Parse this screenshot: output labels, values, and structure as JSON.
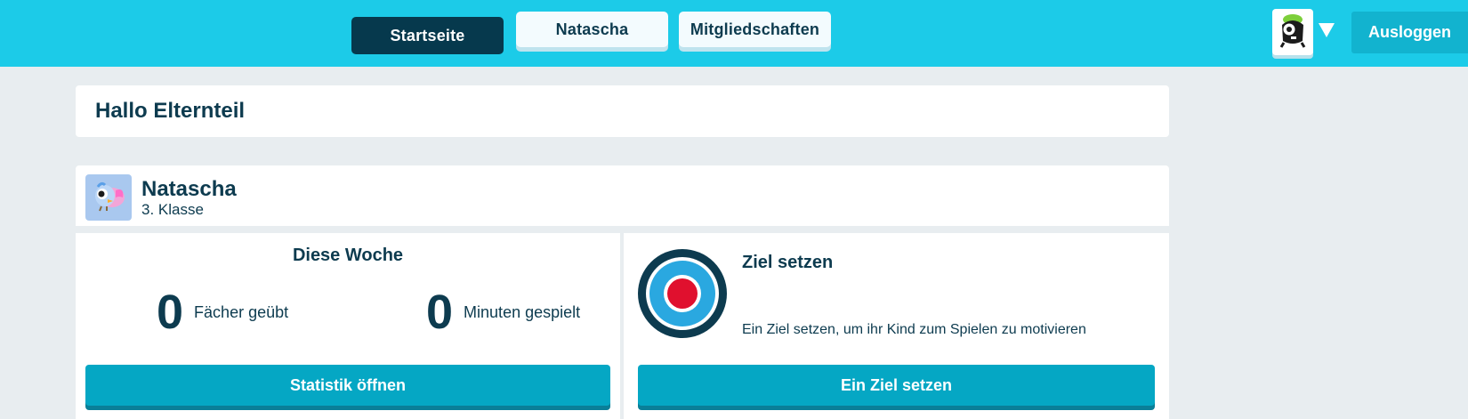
{
  "nav": {
    "tabs": [
      {
        "label": "Startseite",
        "active": true
      },
      {
        "label": "Natascha",
        "active": false
      },
      {
        "label": "Mitgliedschaften",
        "active": false
      }
    ],
    "logout_label": "Ausloggen",
    "account_icon": "monster-avatar-icon",
    "dropdown_icon": "caret-down-icon"
  },
  "greeting": {
    "title": "Hallo Elternteil"
  },
  "child": {
    "name": "Natascha",
    "grade": "3. Klasse",
    "avatar_icon": "bird-avatar-icon"
  },
  "week": {
    "title": "Diese Woche",
    "subjects_value": "0",
    "subjects_label": "Fächer geübt",
    "minutes_value": "0",
    "minutes_label": "Minuten gespielt",
    "button_label": "Statistik öffnen"
  },
  "goal": {
    "title": "Ziel setzen",
    "description": "Ein Ziel setzen, um ihr Kind zum Spielen zu motivieren",
    "button_label": "Ein Ziel setzen",
    "icon": "target-icon"
  },
  "colors": {
    "topbar": "#1ccbe8",
    "primary_dark": "#06394d",
    "button": "#05a7c4",
    "target_red": "#e0102e",
    "target_blue": "#2aa8e0"
  }
}
